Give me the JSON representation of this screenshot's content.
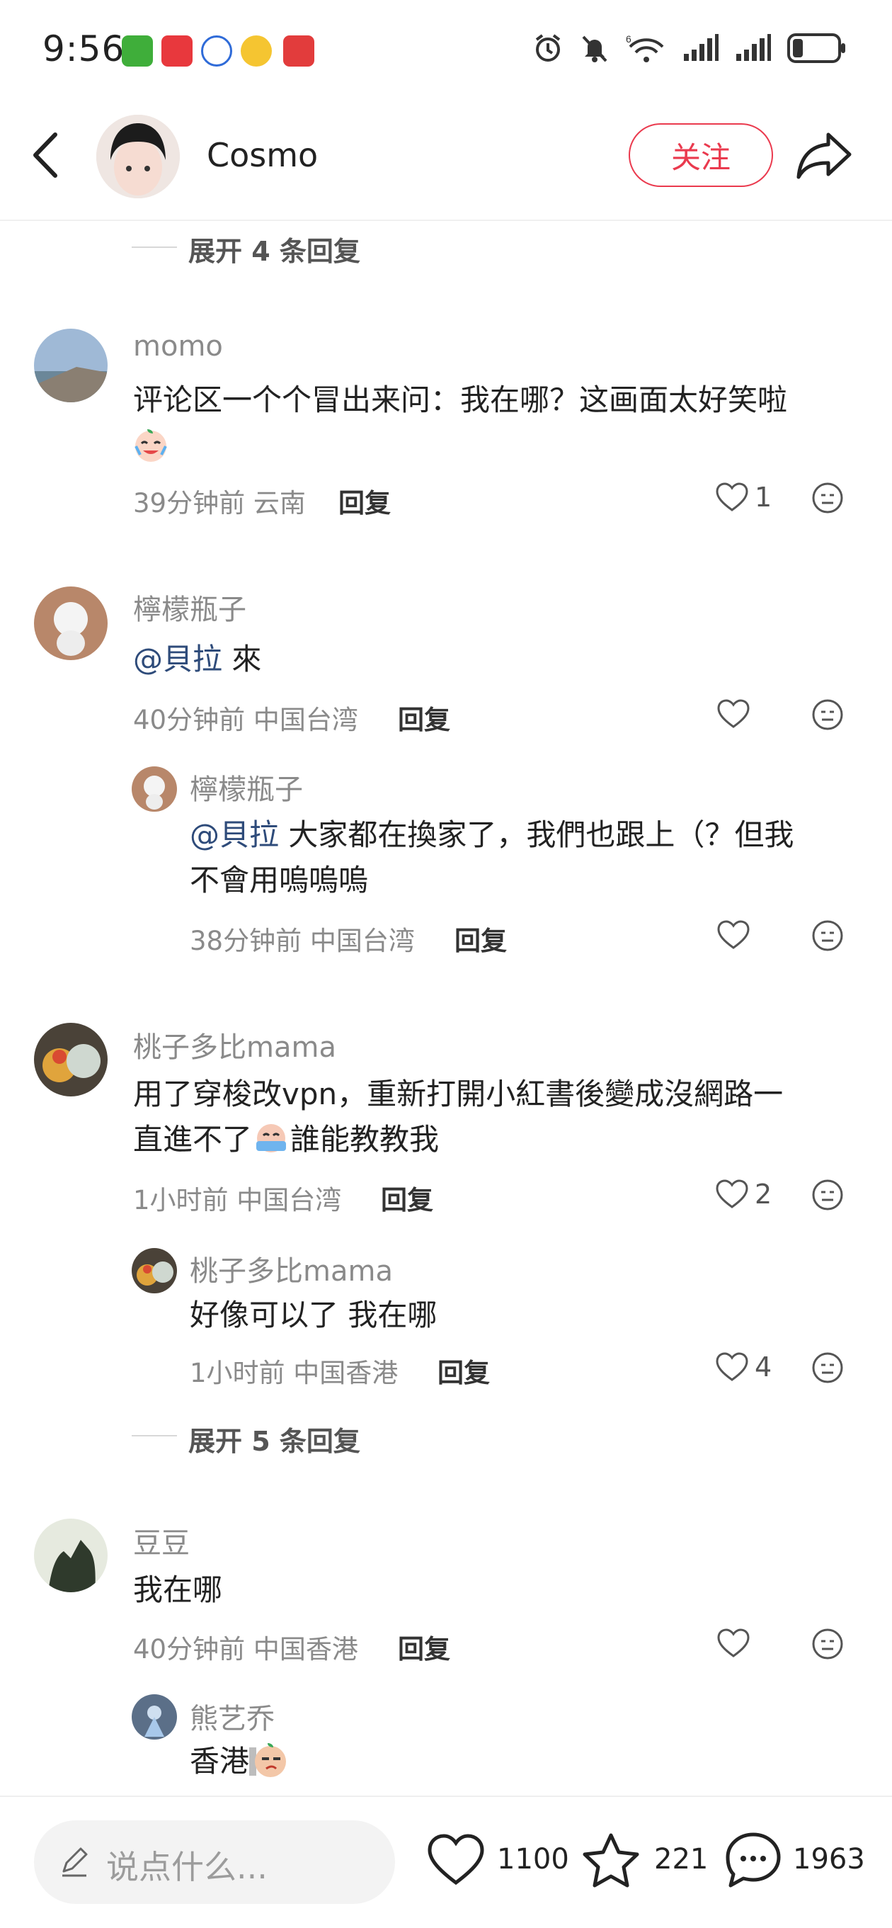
{
  "status_bar": {
    "time": "9:56",
    "app_icons": [
      "jd-icon",
      "red-app-icon",
      "baidu-icon",
      "weibo-icon",
      "ticket-icon"
    ],
    "system_icons": [
      "alarm-icon",
      "mute-icon",
      "wifi-icon",
      "signal-icon",
      "signal-icon",
      "battery-icon"
    ],
    "wifi_label": "6"
  },
  "header": {
    "author": "Cosmo",
    "follow_label": "关注"
  },
  "comments": {
    "expand_1": "展开 4 条回复",
    "c1": {
      "user": "momo",
      "text": "评论区一个个冒出来问：我在哪？这画面太好笑啦",
      "time": "39分钟前 云南",
      "reply": "回复",
      "likes": "1"
    },
    "c2": {
      "user": "檸檬瓶子",
      "mention": "@貝拉",
      "text": " 來",
      "time": "40分钟前 中国台湾",
      "reply": "回复"
    },
    "c2r1": {
      "user": "檸檬瓶子",
      "mention": "@貝拉",
      "text": " 大家都在換家了，我們也跟上（？但我",
      "text2": "不會用嗚嗚嗚",
      "time": "38分钟前 中国台湾",
      "reply": "回复"
    },
    "c3": {
      "user": "桃子多比mama",
      "text": "用了穿梭改vpn，重新打開小紅書後變成沒網路一",
      "text2a": "直進不了",
      "text2b": "誰能教教我",
      "time": "1小时前 中国台湾",
      "reply": "回复",
      "likes": "2"
    },
    "c3r1": {
      "user": "桃子多比mama",
      "text": "好像可以了 我在哪",
      "time": "1小时前 中国香港",
      "reply": "回复",
      "likes": "4"
    },
    "expand_2": "展开 5 条回复",
    "c4": {
      "user": "豆豆",
      "text": "我在哪",
      "time": "40分钟前 中国香港",
      "reply": "回复"
    },
    "c4r1": {
      "user": "熊艺乔",
      "text": "香港"
    }
  },
  "bottom_bar": {
    "placeholder": "说点什么...",
    "likes": "1100",
    "stars": "221",
    "comments": "1963"
  }
}
